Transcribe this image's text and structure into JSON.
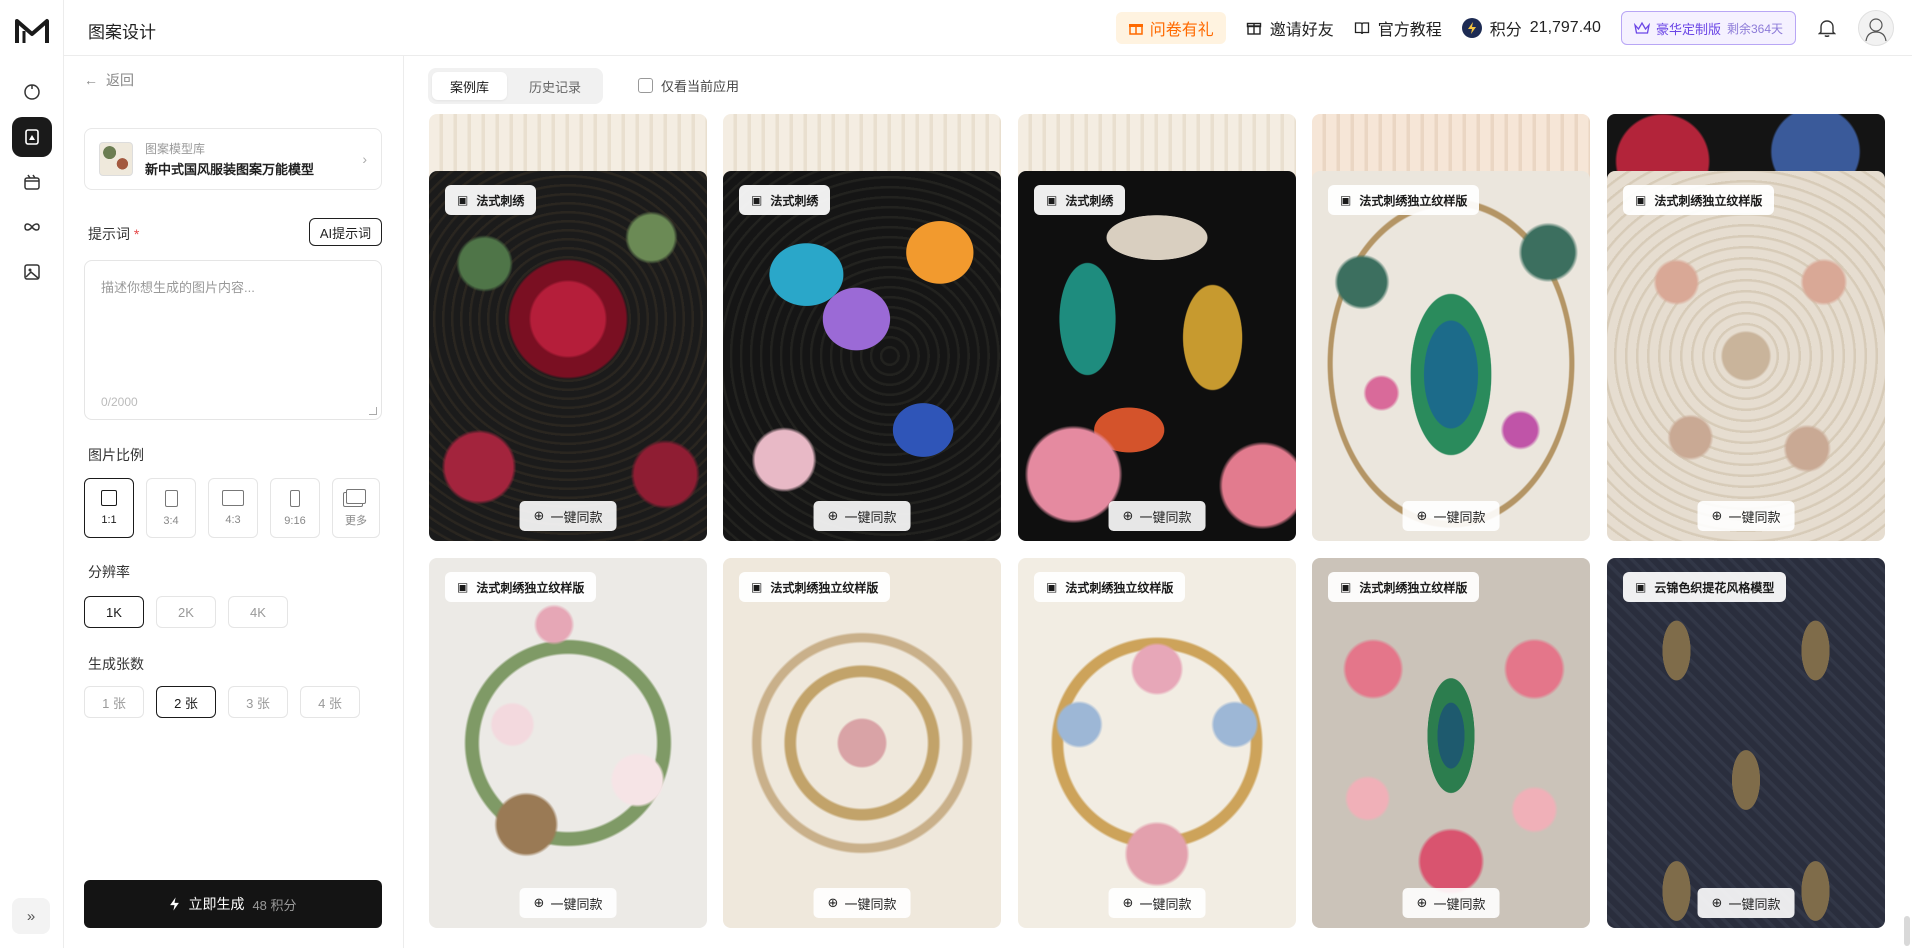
{
  "header": {
    "title": "图案设计",
    "survey": "问卷有礼",
    "invite": "邀请好友",
    "tutorial": "官方教程",
    "points_label": "积分",
    "points_value": "21,797.40",
    "vip_label": "豪华定制版",
    "vip_days": "剩余364天"
  },
  "panel": {
    "back": "返回",
    "model_lib": "图案模型库",
    "model_name": "新中式国风服装图案万能模型",
    "prompt_label": "提示词",
    "prompt_required": "*",
    "ai_prompt": "AI提示词",
    "prompt_placeholder": "描述你想生成的图片内容...",
    "prompt_count": "0/2000",
    "ratio_label": "图片比例",
    "ratios": [
      "1:1",
      "3:4",
      "4:3",
      "9:16",
      "更多"
    ],
    "ratio_selected": "1:1",
    "resolution_label": "分辨率",
    "resolutions": [
      "1K",
      "2K",
      "4K"
    ],
    "resolution_selected": "1K",
    "count_label": "生成张数",
    "counts": [
      "1 张",
      "2 张",
      "3 张",
      "4 张"
    ],
    "count_selected": "2 张",
    "generate": "立即生成",
    "generate_cost": "48 积分"
  },
  "main": {
    "tabs": [
      "案例库",
      "历史记录"
    ],
    "active_tab": "案例库",
    "only_current": "仅看当前应用",
    "same_label": "一键同款",
    "cards": [
      {
        "tag": "法式刺绣"
      },
      {
        "tag": "法式刺绣"
      },
      {
        "tag": "法式刺绣"
      },
      {
        "tag": "法式刺绣独立纹样版"
      },
      {
        "tag": "法式刺绣独立纹样版"
      },
      {
        "tag": "法式刺绣独立纹样版"
      },
      {
        "tag": "法式刺绣独立纹样版"
      },
      {
        "tag": "法式刺绣独立纹样版"
      },
      {
        "tag": "法式刺绣独立纹样版"
      },
      {
        "tag": "云锦色织提花风格模型"
      }
    ]
  }
}
